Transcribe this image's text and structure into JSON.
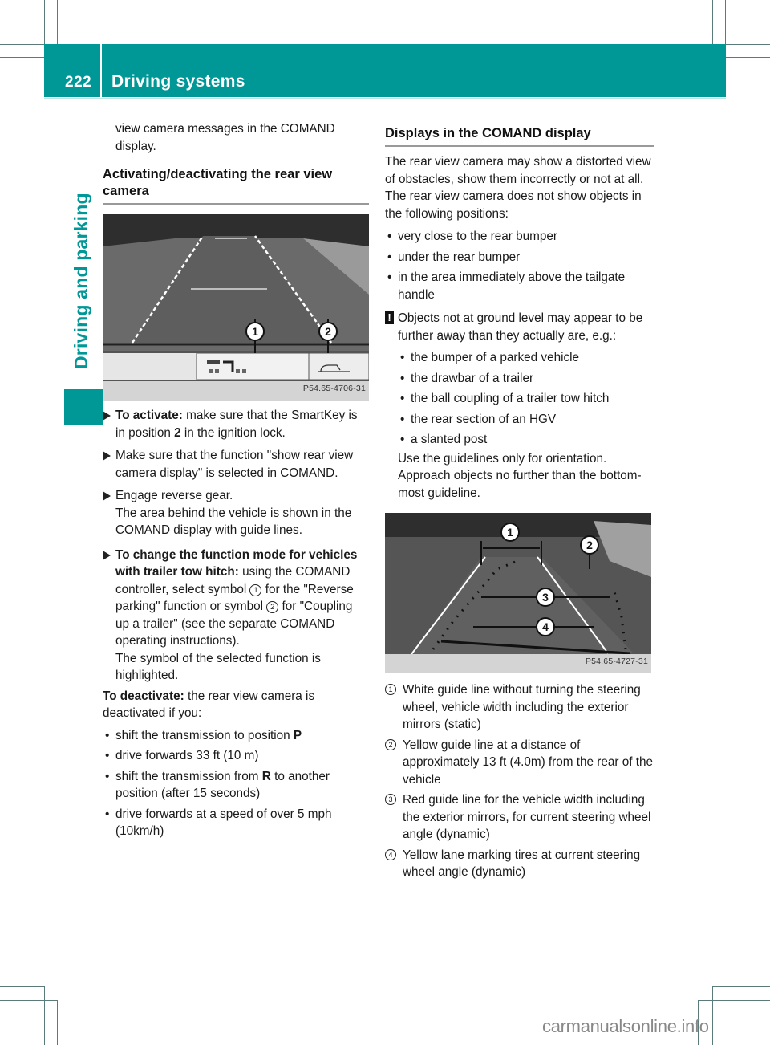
{
  "header": {
    "page_number": "222",
    "section_title": "Driving systems"
  },
  "side_tab": {
    "chapter_title": "Driving and parking",
    "accent_color": "#009797"
  },
  "left_column": {
    "intro_continuation": "view camera messages in the COMAND display.",
    "heading": "Activating/deactivating the rear view camera",
    "figure_1": {
      "figure_id": "P54.65-4706-31",
      "callouts": [
        "1",
        "2"
      ],
      "symbol_1": "reverse-parking-symbol",
      "symbol_2": "coupling-up-trailer-symbol"
    },
    "steps": [
      {
        "bold_lead": "To activate:",
        "text_a": " make sure that the SmartKey is in position ",
        "bold_mid": "2",
        "text_b": " in the ignition lock."
      },
      {
        "text": "Make sure that the function \"show rear view camera display\" is selected in COMAND."
      },
      {
        "text": "Engage reverse gear.",
        "result": "The area behind the vehicle is shown in the COMAND display with guide lines."
      },
      {
        "bold_lead": "To change the function mode for vehicles with trailer tow hitch:",
        "text_a": " using the COMAND controller, select symbol ",
        "ref_1": "1",
        "text_b": " for the \"Reverse parking\" function or symbol ",
        "ref_2": "2",
        "text_c": " for \"Coupling up a trailer\" (see the separate COMAND operating instructions).",
        "result": "The symbol of the selected function is highlighted."
      }
    ],
    "deactivate": {
      "bold_lead": "To deactivate:",
      "text": " the rear view camera is deactivated if you:",
      "bullets": [
        {
          "text": "shift the transmission to position ",
          "bold_end": "P"
        },
        {
          "text": "drive forwards 33 ft (10 m)"
        },
        {
          "text_a": "shift the transmission from ",
          "bold_mid": "R",
          "text_b": " to another position (after 15 seconds)"
        },
        {
          "text": "drive forwards at a speed of over 5 mph (10km/h)"
        }
      ]
    }
  },
  "right_column": {
    "heading": "Displays in the COMAND display",
    "intro": "The rear view camera may show a distorted view of obstacles, show them incorrectly or not at all. The rear view camera does not show objects in the following positions:",
    "positions": [
      "very close to the rear bumper",
      "under the rear bumper",
      "in the area immediately above the tailgate handle"
    ],
    "warning": {
      "icon": "!",
      "text": "Objects not at ground level may appear to be further away than they actually are, e.g.:",
      "examples": [
        "the bumper of a parked vehicle",
        "the drawbar of a trailer",
        "the ball coupling of a trailer tow hitch",
        "the rear section of an HGV",
        "a slanted post"
      ],
      "note": "Use the guidelines only for orientation. Approach objects no further than the bottom-most guideline."
    },
    "figure_2": {
      "figure_id": "P54.65-4727-31",
      "callouts": [
        "1",
        "2",
        "3",
        "4"
      ]
    },
    "legend": [
      {
        "num": "1",
        "text": "White guide line without turning the steering wheel, vehicle width including the exterior mirrors (static)"
      },
      {
        "num": "2",
        "text": "Yellow guide line at a distance of approximately 13 ft (4.0m) from the rear of the vehicle"
      },
      {
        "num": "3",
        "text": "Red guide line for the vehicle width including the exterior mirrors, for current steering wheel angle (dynamic)"
      },
      {
        "num": "4",
        "text": "Yellow lane marking tires at current steering wheel angle (dynamic)"
      }
    ]
  },
  "watermark": "carmanualsonline.info"
}
